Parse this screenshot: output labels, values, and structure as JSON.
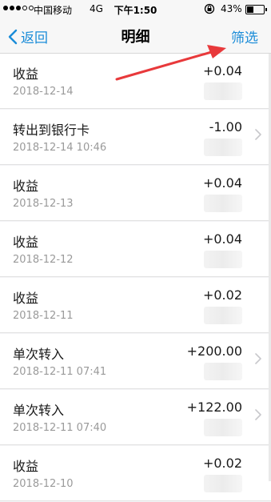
{
  "status_bar": {
    "carrier": "中国移动",
    "network": "4G",
    "time": "下午1:50",
    "battery": "43%",
    "battery_level": 0.43
  },
  "nav": {
    "back_label": "返回",
    "title": "明细",
    "filter_label": "筛选"
  },
  "colors": {
    "accent": "#1a8cd8",
    "annotation_arrow": "#e8393b"
  },
  "transactions": [
    {
      "title": "收益",
      "date": "2018-12-14",
      "amount": "+0.04",
      "chevron": false
    },
    {
      "title": "转出到银行卡",
      "date": "2018-12-14 10:46",
      "amount": "-1.00",
      "chevron": true
    },
    {
      "title": "收益",
      "date": "2018-12-13",
      "amount": "+0.04",
      "chevron": false
    },
    {
      "title": "收益",
      "date": "2018-12-12",
      "amount": "+0.04",
      "chevron": false
    },
    {
      "title": "收益",
      "date": "2018-12-11",
      "amount": "+0.02",
      "chevron": false
    },
    {
      "title": "单次转入",
      "date": "2018-12-11 07:41",
      "amount": "+200.00",
      "chevron": true
    },
    {
      "title": "单次转入",
      "date": "2018-12-11 07:40",
      "amount": "+122.00",
      "chevron": true
    },
    {
      "title": "收益",
      "date": "2018-12-10",
      "amount": "+0.02",
      "chevron": false
    }
  ]
}
